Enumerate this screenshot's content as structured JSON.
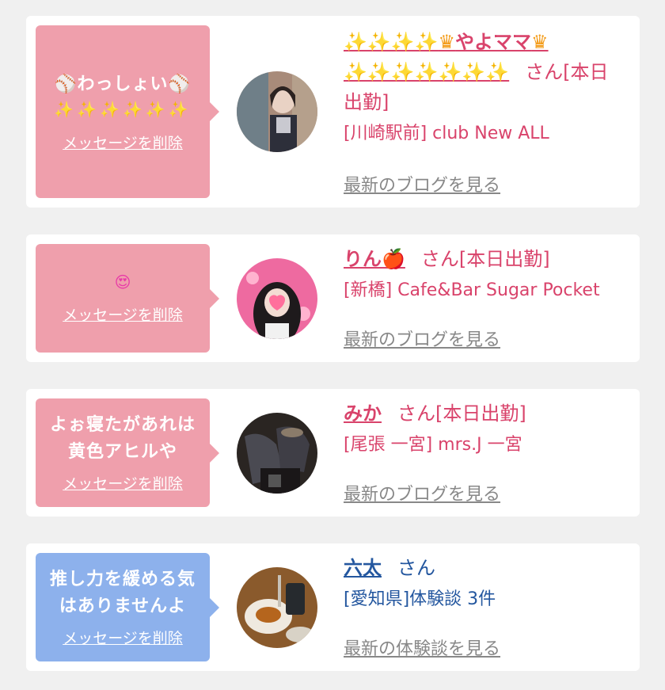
{
  "messages": [
    {
      "bubble_text": "⚾わっしょい⚾",
      "bubble_sparkles": "✨✨✨✨✨✨",
      "delete_label": "メッセージを削除",
      "name_sparkles_1": "✨✨✨✨",
      "name_core": "やよママ",
      "name_sparkles_2": "✨✨✨✨✨✨✨",
      "suffix": "さん[本日出勤]",
      "shop": "[川崎駅前] club New ALL",
      "link_label": "最新のブログを見る",
      "bubble_color": "#ef9fac",
      "avatar_icon": "profile-photo"
    },
    {
      "bubble_emoji": "😍",
      "delete_label": "メッセージを削除",
      "name": "りん",
      "name_emoji": "🍎",
      "suffix": "さん[本日出勤]",
      "shop": "[新橋] Cafe&Bar Sugar Pocket",
      "link_label": "最新のブログを見る",
      "bubble_color": "#ef9fac",
      "avatar_icon": "profile-photo"
    },
    {
      "bubble_text": "よぉ寝たがあれは黄色アヒルや",
      "delete_label": "メッセージを削除",
      "name": "みか",
      "suffix": "さん[本日出勤]",
      "shop": "[尾張 一宮] mrs.J 一宮",
      "link_label": "最新のブログを見る",
      "bubble_color": "#ef9fac",
      "avatar_icon": "profile-photo"
    },
    {
      "bubble_text": "推し力を緩める気はありませんよ",
      "delete_label": "メッセージを削除",
      "name": "六太",
      "suffix": "さん",
      "shop": "[愛知県]体験談 3件",
      "link_label": "最新の体験談を見る",
      "bubble_color": "#8db1ec",
      "avatar_icon": "profile-photo"
    }
  ]
}
